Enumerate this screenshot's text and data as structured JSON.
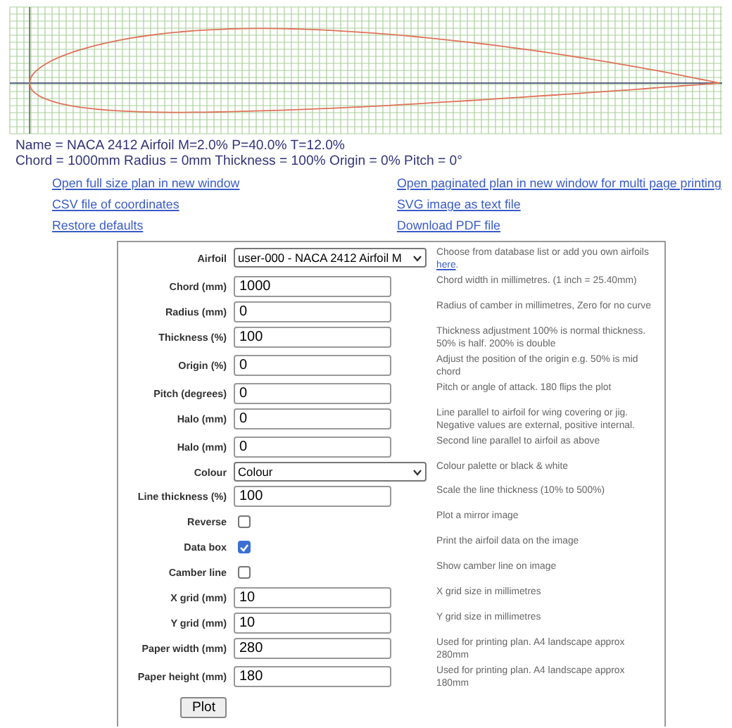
{
  "info_lines": [
    "Name = NACA 2412 Airfoil M=2.0% P=40.0% T=12.0%",
    "Chord = 1000mm Radius = 0mm Thickness = 100% Origin = 0% Pitch = 0°"
  ],
  "links": [
    {
      "label": "Open full size plan in new window"
    },
    {
      "label": "Open paginated plan in new window for multi page printing"
    },
    {
      "label": "CSV file of coordinates"
    },
    {
      "label": "SVG image as text file"
    },
    {
      "label": "Restore defaults"
    },
    {
      "label": "Download PDF file"
    }
  ],
  "form": {
    "rows": [
      {
        "kind": "select",
        "label": "Airfoil",
        "value": "user-000 - NACA 2412 Airfoil M",
        "help": "Choose from database list or add you own airfoils ",
        "help_link": "here",
        "help_suffix": "."
      },
      {
        "kind": "text",
        "label": "Chord (mm)",
        "value": "1000",
        "help": "Chord width in millimetres. (1 inch = 25.40mm)"
      },
      {
        "kind": "text",
        "label": "Radius (mm)",
        "value": "0",
        "help": "Radius of camber in millimetres, Zero for no curve"
      },
      {
        "kind": "text",
        "label": "Thickness (%)",
        "value": "100",
        "help": "Thickness adjustment 100% is normal thickness. 50% is half. 200% is double"
      },
      {
        "kind": "text",
        "label": "Origin (%)",
        "value": "0",
        "help": "Adjust the position of the origin e.g. 50% is mid chord"
      },
      {
        "kind": "text",
        "label": "Pitch (degrees)",
        "value": "0",
        "help": "Pitch or angle of attack. 180 flips the plot"
      },
      {
        "kind": "text",
        "label": "Halo (mm)",
        "value": "0",
        "help": "Line parallel to airfoil for wing covering or jig. Negative values are external, positive internal."
      },
      {
        "kind": "text",
        "label": "Halo (mm)",
        "value": "0",
        "help": "Second line parallel to airfoil as above"
      },
      {
        "kind": "select",
        "label": "Colour",
        "value": "Colour",
        "help": "Colour palette or black & white"
      },
      {
        "kind": "text",
        "label": "Line thickness (%)",
        "value": "100",
        "help": "Scale the line thickness (10% to 500%)"
      },
      {
        "kind": "checkbox",
        "label": "Reverse",
        "checked": false,
        "help": "Plot a mirror image"
      },
      {
        "kind": "checkbox",
        "label": "Data box",
        "checked": true,
        "help": "Print the airfoil data on the image"
      },
      {
        "kind": "checkbox",
        "label": "Camber line",
        "checked": false,
        "help": "Show camber line on image"
      },
      {
        "kind": "text",
        "label": "X grid (mm)",
        "value": "10",
        "help": "X grid size in millimetres"
      },
      {
        "kind": "text",
        "label": "Y grid (mm)",
        "value": "10",
        "help": "Y grid size in millimetres"
      },
      {
        "kind": "text",
        "label": "Paper width (mm)",
        "value": "280",
        "help": "Used for printing plan. A4 landscape approx 280mm"
      },
      {
        "kind": "text",
        "label": "Paper height (mm)",
        "value": "180",
        "help": "Used for printing plan. A4 landscape approx 180mm"
      }
    ],
    "button": "Plot"
  }
}
